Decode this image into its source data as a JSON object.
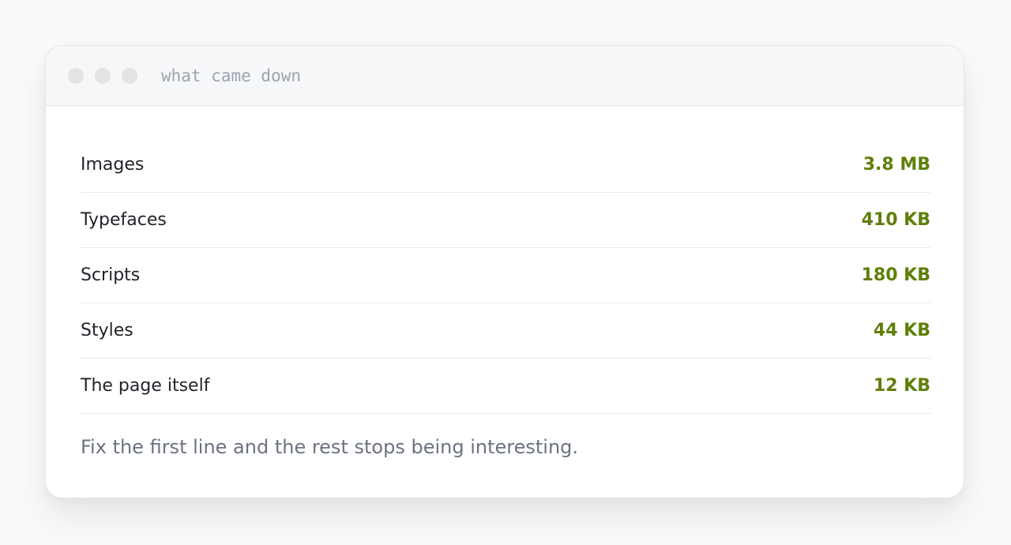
{
  "window": {
    "title": "what came down"
  },
  "rows": [
    {
      "label": "Images",
      "value": "3.8 MB"
    },
    {
      "label": "Typefaces",
      "value": "410 KB"
    },
    {
      "label": "Scripts",
      "value": "180 KB"
    },
    {
      "label": "Styles",
      "value": "44 KB"
    },
    {
      "label": "The page itself",
      "value": "12 KB"
    }
  ],
  "footnote": "Fix the first line and the rest stops being interesting.",
  "colors": {
    "value_accent": "#5f7f0a",
    "label_text": "#1f2328",
    "muted_text": "#6b7280",
    "titlebar_bg": "#f6f7f8"
  }
}
